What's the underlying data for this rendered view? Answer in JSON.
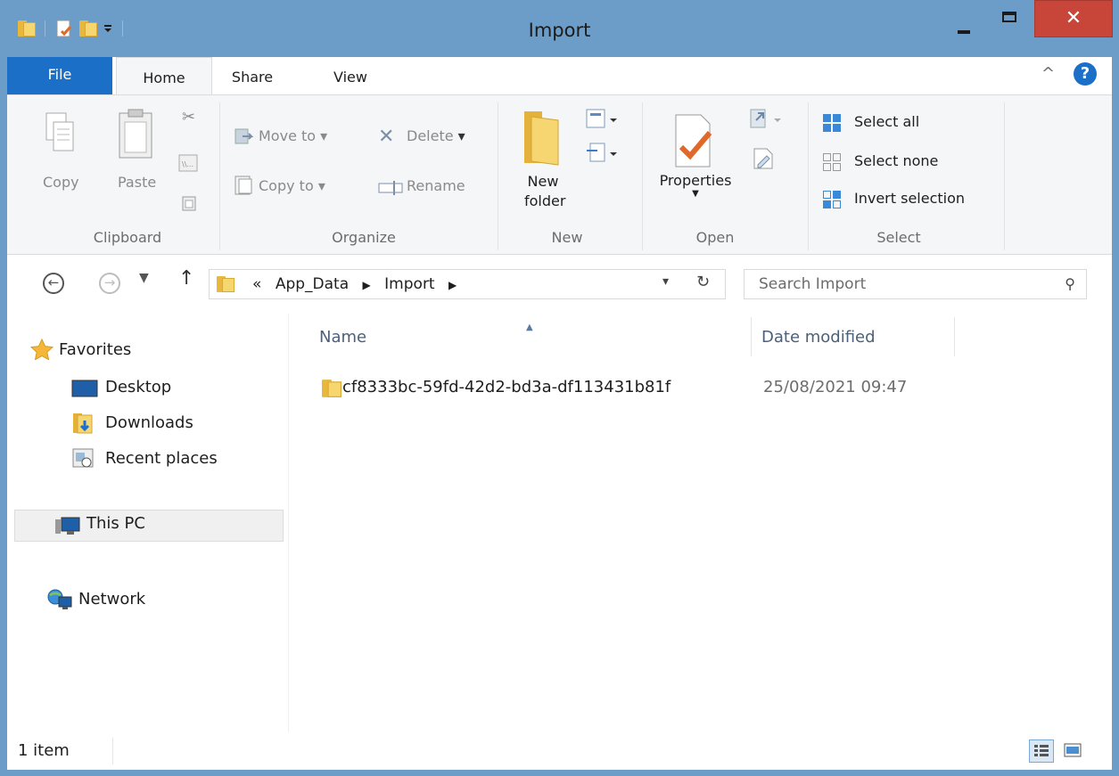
{
  "window": {
    "title": "Import"
  },
  "title_buttons": {
    "close": "✕"
  },
  "ribbon_tabs": {
    "file": "File",
    "home": "Home",
    "share": "Share",
    "view": "View",
    "help": "?"
  },
  "clipboard": {
    "copy": "Copy",
    "paste": "Paste",
    "group": "Clipboard"
  },
  "organize": {
    "move_to": "Move to",
    "copy_to": "Copy to",
    "delete": "Delete",
    "rename": "Rename",
    "group": "Organize"
  },
  "new": {
    "new_folder_line1": "New",
    "new_folder_line2": "folder",
    "group": "New"
  },
  "open": {
    "properties": "Properties",
    "group": "Open"
  },
  "select": {
    "select_all": "Select all",
    "select_none": "Select none",
    "invert": "Invert selection",
    "group": "Select"
  },
  "address": {
    "overflow": "«",
    "crumb1": "App_Data",
    "crumb2": "Import"
  },
  "search": {
    "placeholder": "Search Import"
  },
  "nav_pane": {
    "favorites": "Favorites",
    "desktop": "Desktop",
    "downloads": "Downloads",
    "recent": "Recent places",
    "this_pc": "This PC",
    "network": "Network"
  },
  "columns": {
    "name": "Name",
    "date_modified": "Date modified"
  },
  "files": [
    {
      "name": "cf8333bc-59fd-42d2-bd3a-df113431b81f",
      "date": "25/08/2021 09:47"
    }
  ],
  "status": {
    "item_count": "1 item"
  },
  "colors": {
    "titlebar": "#6c9cc8",
    "file_tab": "#1b6fc7",
    "close": "#c8453a"
  }
}
